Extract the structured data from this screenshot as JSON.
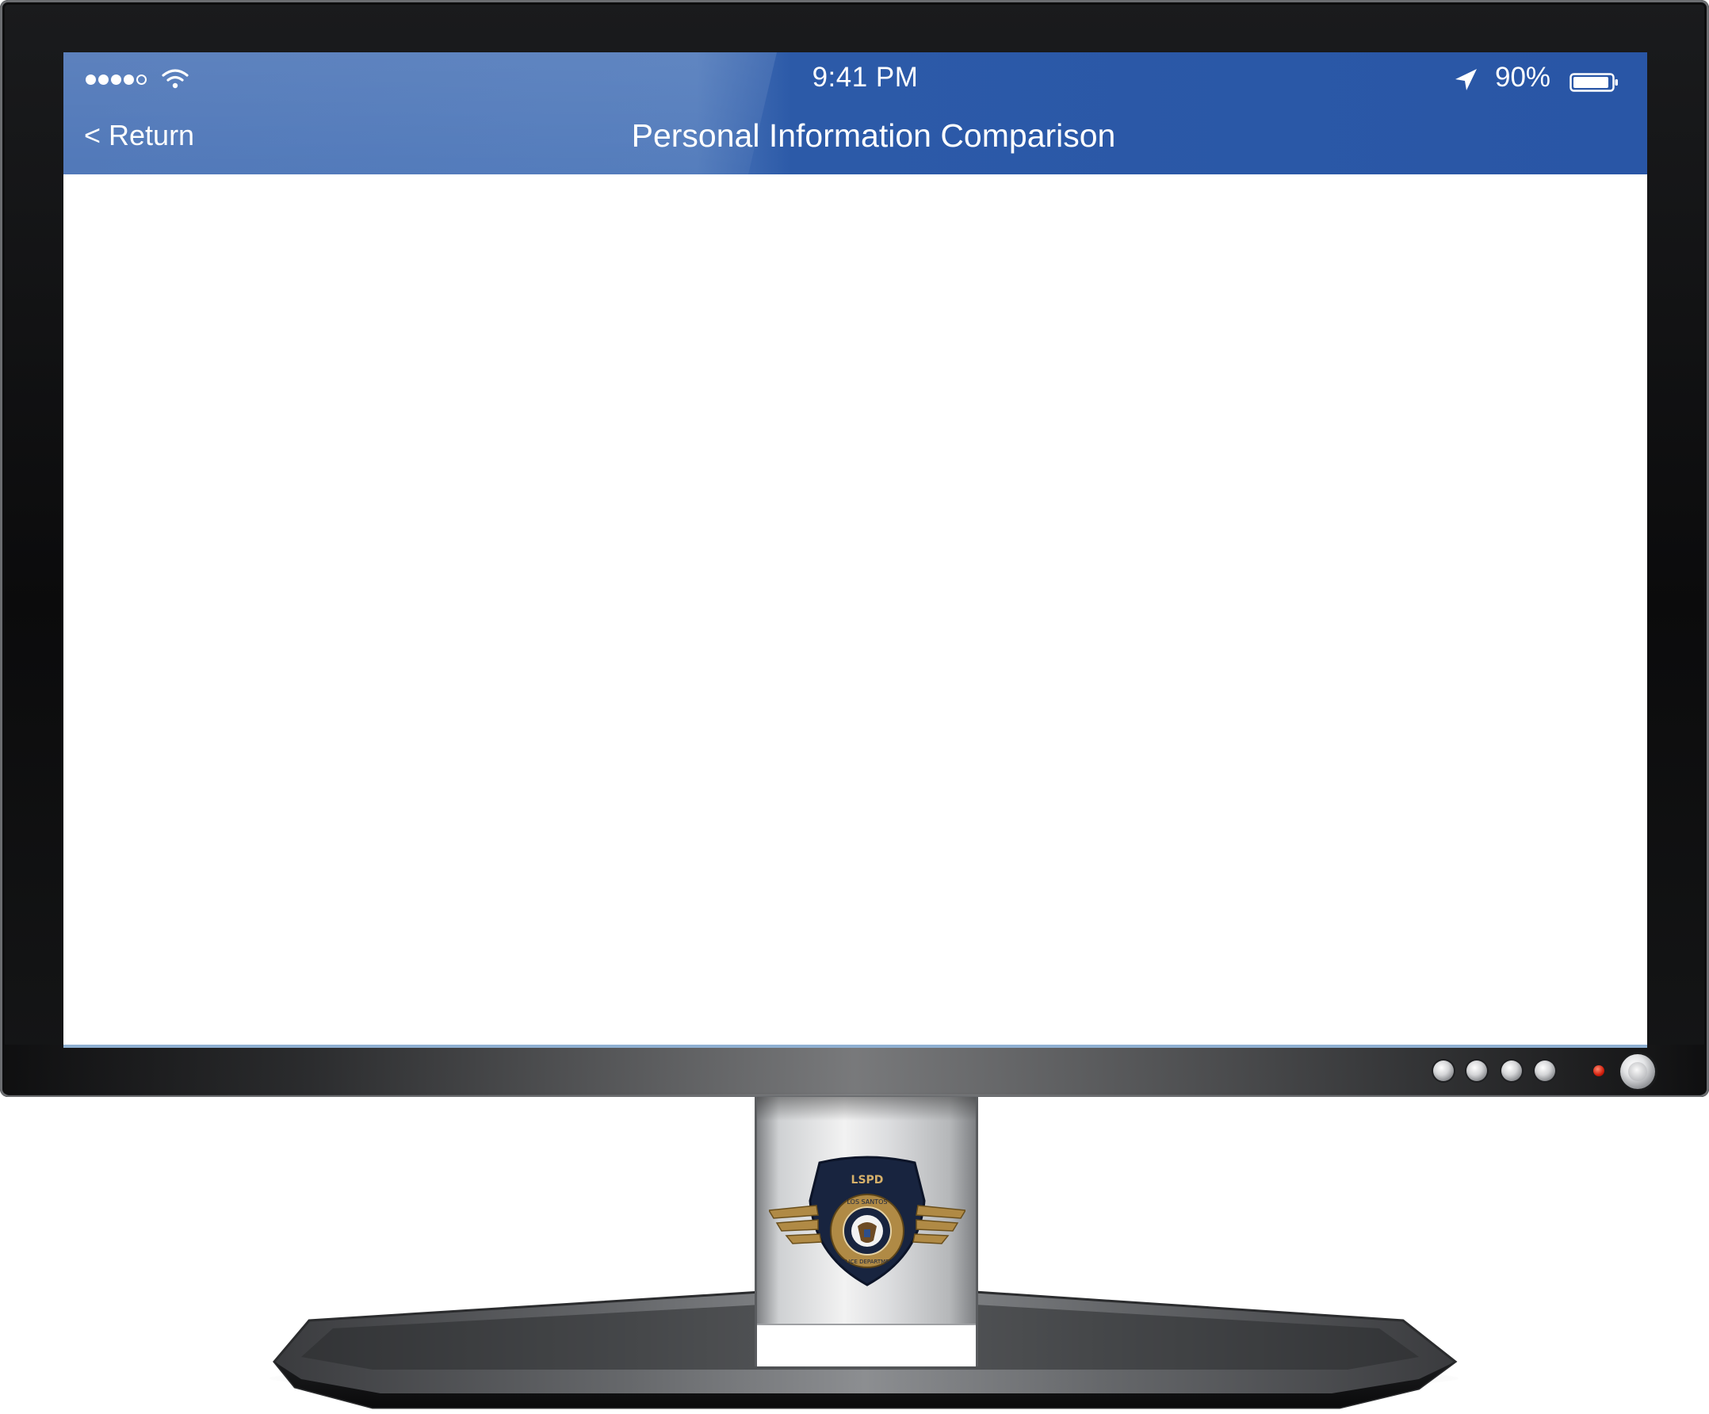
{
  "status_bar": {
    "time": "9:41 PM",
    "battery_percent": "90%",
    "signal_bars_filled": 4,
    "signal_bars_total": 5,
    "icons": [
      "signal-dots-icon",
      "wifi-icon",
      "location-arrow-icon",
      "battery-icon"
    ]
  },
  "nav": {
    "back_label": "< Return",
    "title": "Personal Information Comparison"
  },
  "content": {
    "items": []
  },
  "monitor": {
    "emblem": {
      "top_text": "LSPD",
      "ring_text_top": "LOS SANTOS",
      "ring_text_bottom": "POLICE DEPARTMENT"
    },
    "hardware_buttons": [
      "menu-button",
      "down-button",
      "up-button",
      "input-button"
    ],
    "power_led_color": "#d21e0c"
  },
  "colors": {
    "nav_bar": "#2956a6",
    "nav_bar_left": "#4a73b6",
    "screen_background": "#ffffff",
    "bezel": "#0b0b0c"
  }
}
